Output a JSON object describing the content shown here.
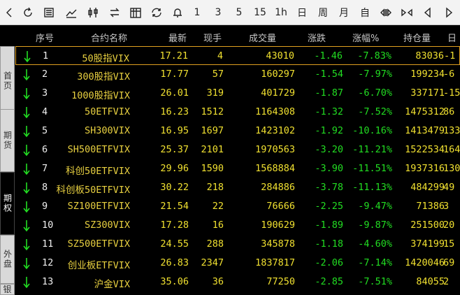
{
  "toolbar": {
    "period_labels": [
      "1",
      "3",
      "5",
      "15",
      "1h",
      "日",
      "周",
      "月",
      "自"
    ]
  },
  "sidetabs": {
    "tabs": [
      {
        "label": "首页"
      },
      {
        "label": "期货"
      },
      {
        "label": "期权"
      },
      {
        "label": "外盘"
      },
      {
        "label": "银"
      }
    ]
  },
  "columns": [
    "序号",
    "合约名称",
    "最新",
    "现手",
    "成交量",
    "涨跌",
    "涨幅%",
    "持仓量",
    "日"
  ],
  "rows": [
    {
      "idx": "1",
      "name": "50股指VIX",
      "last": "17.21",
      "hand": "4",
      "vol": "43010",
      "chg": "-1.46",
      "pct": "-7.83%",
      "oi": "83036",
      "day": "-1"
    },
    {
      "idx": "2",
      "name": "300股指VIX",
      "last": "17.77",
      "hand": "57",
      "vol": "160297",
      "chg": "-1.54",
      "pct": "-7.97%",
      "oi": "199234",
      "day": "-6"
    },
    {
      "idx": "3",
      "name": "1000股指VIX",
      "last": "26.01",
      "hand": "319",
      "vol": "401729",
      "chg": "-1.87",
      "pct": "-6.70%",
      "oi": "337171",
      "day": "-15"
    },
    {
      "idx": "4",
      "name": "50ETFVIX",
      "last": "16.23",
      "hand": "1512",
      "vol": "1164308",
      "chg": "-1.32",
      "pct": "-7.52%",
      "oi": "1475312",
      "day": "86"
    },
    {
      "idx": "5",
      "name": "SH300VIX",
      "last": "16.95",
      "hand": "1697",
      "vol": "1423102",
      "chg": "-1.92",
      "pct": "-10.16%",
      "oi": "1413479",
      "day": "133"
    },
    {
      "idx": "6",
      "name": "SH500ETFVIX",
      "last": "25.37",
      "hand": "2101",
      "vol": "1970563",
      "chg": "-3.20",
      "pct": "-11.21%",
      "oi": "1522534",
      "day": "164"
    },
    {
      "idx": "7",
      "name": "科创50ETFVIX",
      "last": "29.96",
      "hand": "1590",
      "vol": "1568884",
      "chg": "-3.90",
      "pct": "-11.51%",
      "oi": "1937316",
      "day": "130"
    },
    {
      "idx": "8",
      "name": "科创板50ETFVIX",
      "last": "30.22",
      "hand": "218",
      "vol": "284886",
      "chg": "-3.78",
      "pct": "-11.13%",
      "oi": "484299",
      "day": "49"
    },
    {
      "idx": "9",
      "name": "SZ100ETFVIX",
      "last": "21.54",
      "hand": "22",
      "vol": "76666",
      "chg": "-2.25",
      "pct": "-9.47%",
      "oi": "71386",
      "day": "3"
    },
    {
      "idx": "10",
      "name": "SZ300VIX",
      "last": "17.28",
      "hand": "16",
      "vol": "190629",
      "chg": "-1.89",
      "pct": "-9.87%",
      "oi": "251500",
      "day": "20"
    },
    {
      "idx": "11",
      "name": "SZ500ETFVIX",
      "last": "24.55",
      "hand": "288",
      "vol": "345878",
      "chg": "-1.18",
      "pct": "-4.60%",
      "oi": "374199",
      "day": "15"
    },
    {
      "idx": "12",
      "name": "创业板ETFVIX",
      "last": "26.83",
      "hand": "2347",
      "vol": "1837817",
      "chg": "-2.06",
      "pct": "-7.14%",
      "oi": "1420046",
      "day": "69"
    },
    {
      "idx": "13",
      "name": "沪金VIX",
      "last": "35.06",
      "hand": "36",
      "vol": "77250",
      "chg": "-2.85",
      "pct": "-7.51%",
      "oi": "84055",
      "day": "2"
    }
  ],
  "colors": {
    "up": "#22dd22",
    "name": "#e8d040",
    "value": "#f0e030",
    "selection": "#e0a020"
  }
}
